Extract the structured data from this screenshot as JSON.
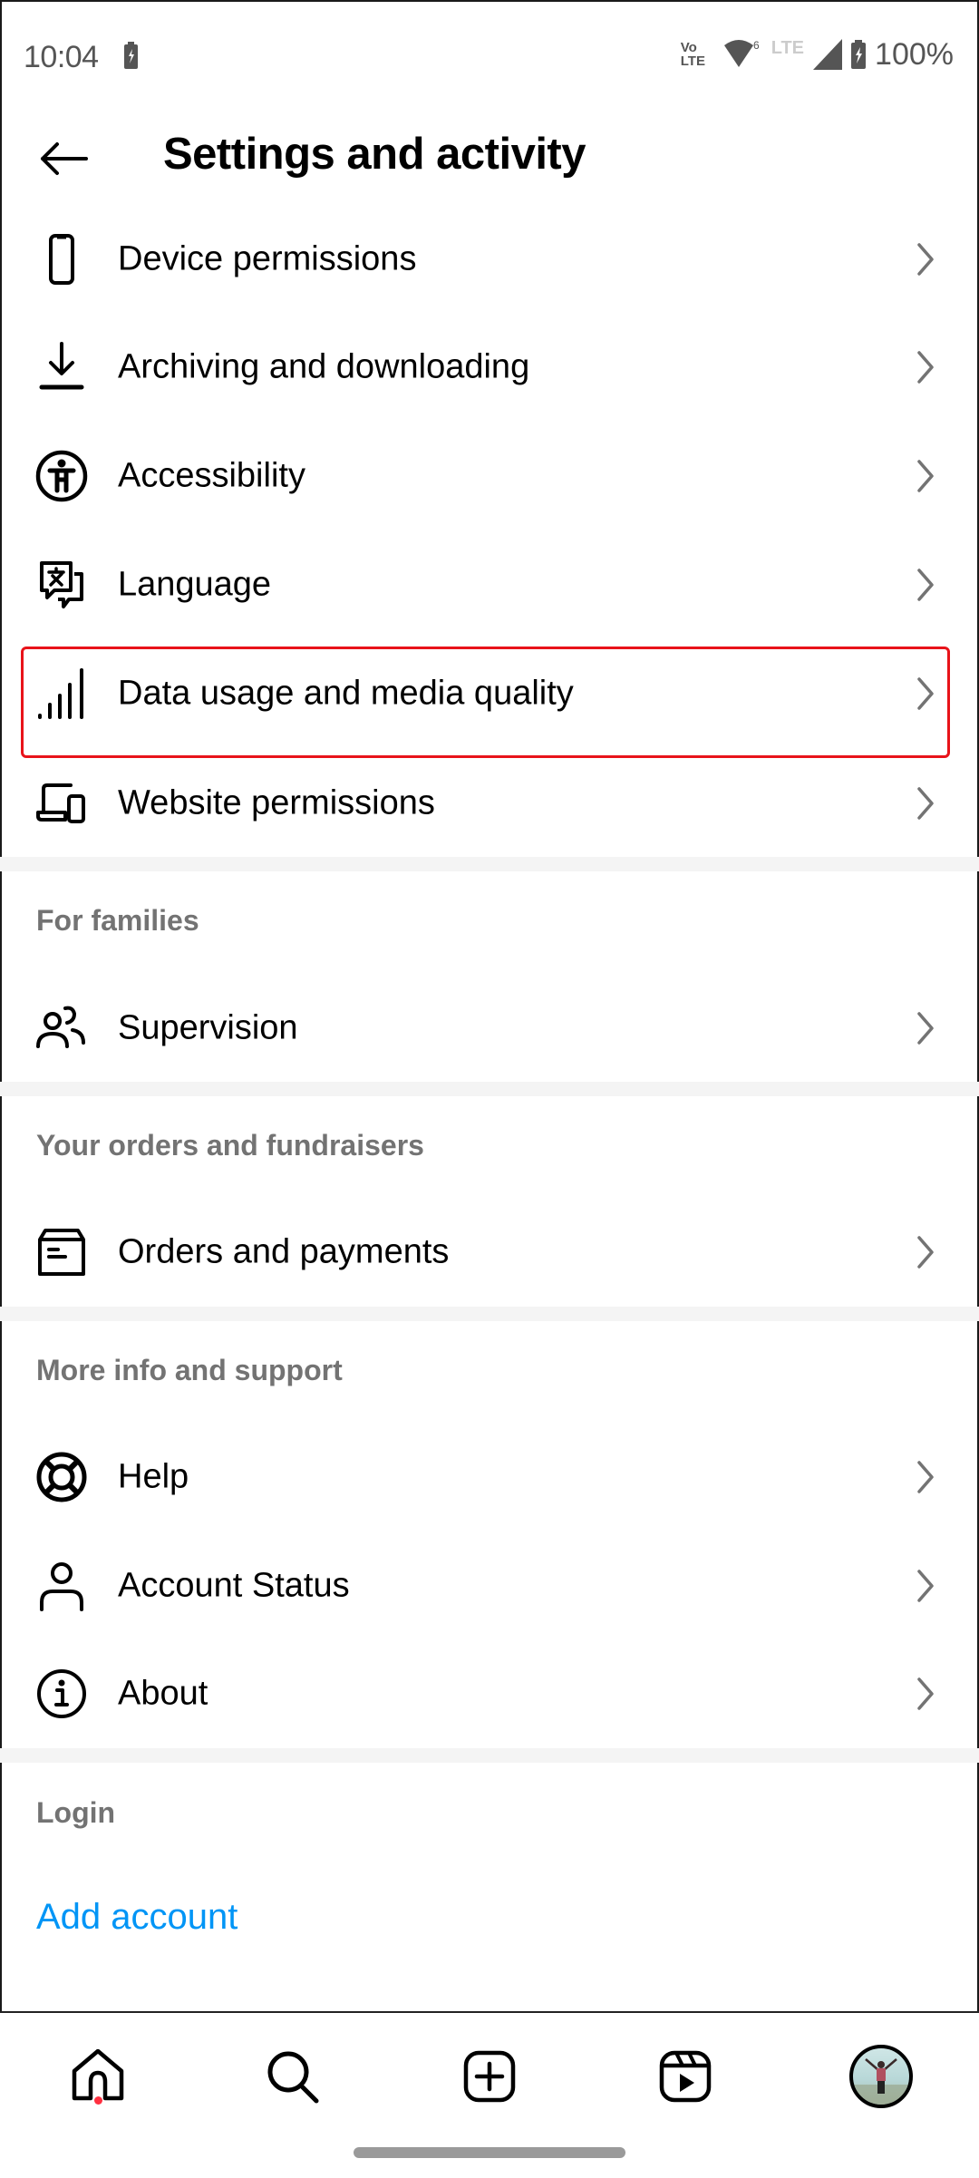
{
  "status_bar": {
    "time": "10:04",
    "volte_top": "Vo",
    "volte_bottom": "LTE",
    "wifi_badge": "6",
    "network_label": "LTE",
    "battery_percent": "100%"
  },
  "header": {
    "title": "Settings and activity",
    "back_icon": "arrow-left-icon"
  },
  "sections": [
    {
      "header": null,
      "items": [
        {
          "label": "Device permissions",
          "icon": "phone-icon"
        },
        {
          "label": "Archiving and downloading",
          "icon": "download-icon"
        },
        {
          "label": "Accessibility",
          "icon": "accessibility-icon"
        },
        {
          "label": "Language",
          "icon": "translate-icon"
        },
        {
          "label": "Data usage and media quality",
          "icon": "signal-bars-icon",
          "highlighted": true
        },
        {
          "label": "Website permissions",
          "icon": "devices-icon"
        }
      ]
    },
    {
      "header": "For families",
      "items": [
        {
          "label": "Supervision",
          "icon": "people-icon"
        }
      ]
    },
    {
      "header": "Your orders and fundraisers",
      "items": [
        {
          "label": "Orders and payments",
          "icon": "package-icon"
        }
      ]
    },
    {
      "header": "More info and support",
      "items": [
        {
          "label": "Help",
          "icon": "lifebuoy-icon"
        },
        {
          "label": "Account Status",
          "icon": "person-icon"
        },
        {
          "label": "About",
          "icon": "info-icon"
        }
      ]
    },
    {
      "header": "Login",
      "items": []
    }
  ],
  "login": {
    "add_account": "Add account"
  },
  "bottom_nav": [
    {
      "name": "home",
      "icon": "home-icon",
      "has_notification": true
    },
    {
      "name": "search",
      "icon": "search-icon"
    },
    {
      "name": "create",
      "icon": "plus-square-icon"
    },
    {
      "name": "reels",
      "icon": "reels-icon"
    },
    {
      "name": "profile",
      "icon": "avatar"
    }
  ],
  "colors": {
    "highlight_border": "#e8131a",
    "link_blue": "#0095f6",
    "section_header_gray": "#737373",
    "notification_dot": "#ff3040"
  }
}
